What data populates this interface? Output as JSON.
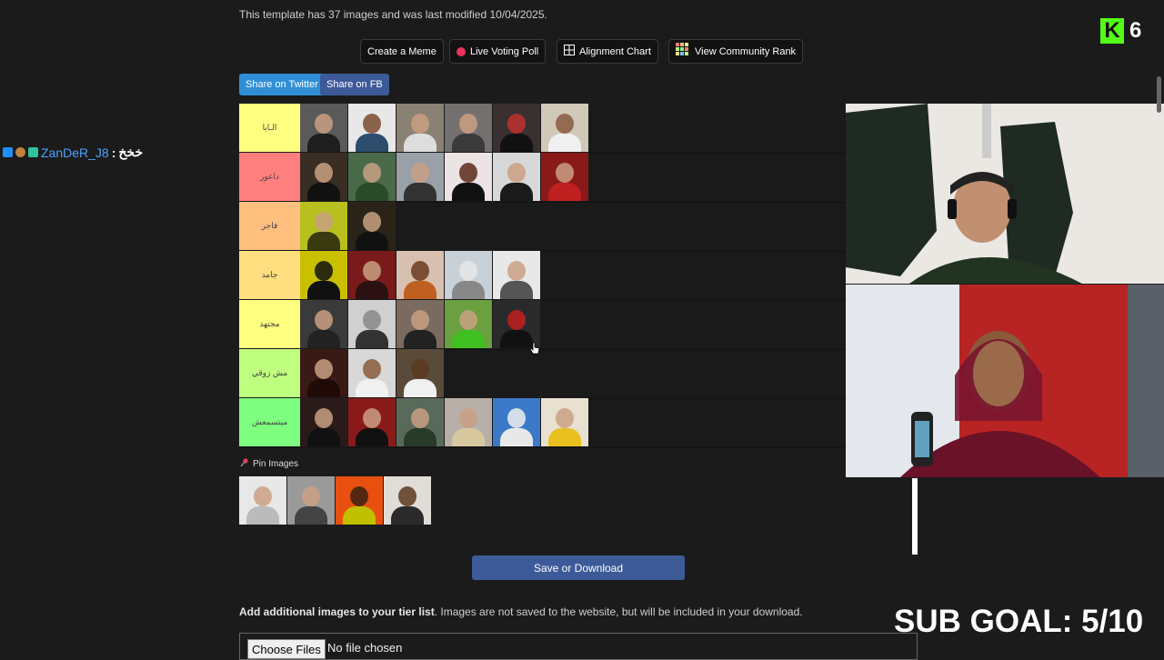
{
  "header": {
    "info": "This template has 37 images and was last modified 10/04/2025."
  },
  "kick": {
    "logo": "K",
    "count": "6"
  },
  "toolbar": {
    "create_meme": "Create a Meme",
    "voting_poll": "Live Voting Poll",
    "alignment_chart": "Alignment Chart",
    "community_rank": "View Community Rank"
  },
  "share": {
    "twitter": "Share on Twitter",
    "fb": "Share on FB"
  },
  "chat": {
    "username": "ZanDeR_J8",
    "separator": ":",
    "message": "خخخ"
  },
  "tiers": [
    {
      "label": "الـايا",
      "color": "#ffff7f",
      "count": 6
    },
    {
      "label": "داعور",
      "color": "#ff7f7f",
      "count": 6
    },
    {
      "label": "فاجر",
      "color": "#ffbf7f",
      "count": 2
    },
    {
      "label": "جامد",
      "color": "#ffdf7f",
      "count": 5
    },
    {
      "label": "مجتهد",
      "color": "#ffff7f",
      "count": 5
    },
    {
      "label": "مش زوقي",
      "color": "#bfff7f",
      "count": 3
    },
    {
      "label": "ميتسمعش",
      "color": "#7fff7f",
      "count": 6
    }
  ],
  "pins": {
    "label": "Pin Images",
    "count": 4
  },
  "save": {
    "label": "Save or Download"
  },
  "add_images": {
    "bold": "Add additional images to your tier list",
    "rest": ". Images are not saved to the website, but will be included in your download."
  },
  "file_input": {
    "button": "Choose Files",
    "status": "No file chosen"
  },
  "overlay": {
    "sub_goal": "SUB GOAL: 5/10"
  },
  "colors": {
    "accent_save": "#3d5a98",
    "twitter": "#1da1f2",
    "facebook": "#3b5998",
    "kick_green": "#53fc18"
  }
}
